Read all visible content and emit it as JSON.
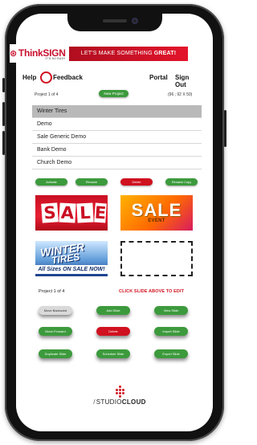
{
  "header": {
    "logo_text": "ThinkSIGN",
    "logo_sub": "IT'S SO EASY",
    "tagline": "LET'S MAKE SOMETHING",
    "tagline_strong": "GREAT!"
  },
  "nav": {
    "help": "Help",
    "feedback": "Feedback",
    "portal": "Portal",
    "sign_out": "Sign Out"
  },
  "project_bar": {
    "project_label": "Project 1 of 4",
    "new_project": "New Project",
    "dimensions": "(96 ; 92 X 50)"
  },
  "projects": [
    "Winter Tires",
    "Demo",
    "Sale Generic Demo",
    "Bank Demo",
    "Church Demo"
  ],
  "project_actions": {
    "action_1": "Activate",
    "action_2": "Rename",
    "action_3": "Delete",
    "action_4": "Rename Copy"
  },
  "slides": {
    "slide1_text": [
      "S",
      "A",
      "L",
      "E"
    ],
    "slide2_title": "SALE",
    "slide2_sub": "EVENT",
    "slide3_title": "WINTER",
    "slide3_title2": "TIRES",
    "slide3_band": "All Sizes ON SALE NOW!"
  },
  "slide_footer": {
    "slide_count": "Project 1 of 4",
    "edit_hint": "CLICK SLIDE ABOVE TO EDIT"
  },
  "buttons": {
    "move_backward": "Move Backward",
    "add_slide": "Add Slide",
    "view_slide": "View Slide",
    "move_forward": "Move Forward",
    "delete": "Delete",
    "import_slide": "Import Slide",
    "duplicate_slide": "Duplicate Slide",
    "schedule_slide": "Schedule Slide",
    "export_slide": "Export Slide"
  },
  "footer": {
    "brand_prefix": "STUDIO",
    "brand_strong": "CLOUD"
  },
  "colors": {
    "brand_red": "#d0111f",
    "action_green": "#3c9a3c",
    "selected_row": "#b9b9b9"
  }
}
